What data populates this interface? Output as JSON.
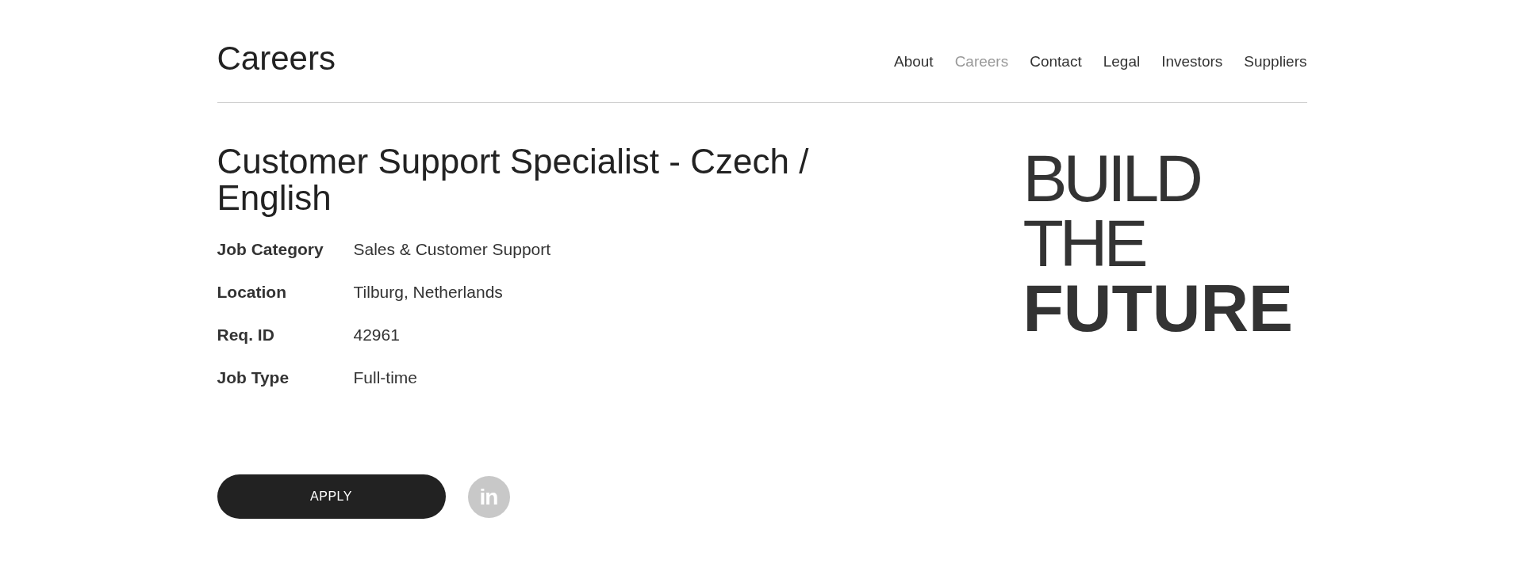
{
  "header": {
    "title": "Careers",
    "nav": [
      {
        "label": "About",
        "selected": false
      },
      {
        "label": "Careers",
        "selected": true
      },
      {
        "label": "Contact",
        "selected": false
      },
      {
        "label": "Legal",
        "selected": false
      },
      {
        "label": "Investors",
        "selected": false
      },
      {
        "label": "Suppliers",
        "selected": false
      }
    ]
  },
  "job": {
    "title": "Customer Support Specialist - Czech / English",
    "details": [
      {
        "label": "Job Category",
        "value": "Sales & Customer Support"
      },
      {
        "label": "Location",
        "value": "Tilburg, Netherlands"
      },
      {
        "label": "Req. ID",
        "value": "42961"
      },
      {
        "label": "Job Type",
        "value": "Full-time"
      }
    ],
    "apply_button": "APPLY",
    "share_button": "in"
  },
  "promo": {
    "lines": [
      {
        "text": "BUILD",
        "kind": "light"
      },
      {
        "text": "THE",
        "kind": "light"
      },
      {
        "text": "FUTURE",
        "kind": "bold"
      }
    ]
  }
}
